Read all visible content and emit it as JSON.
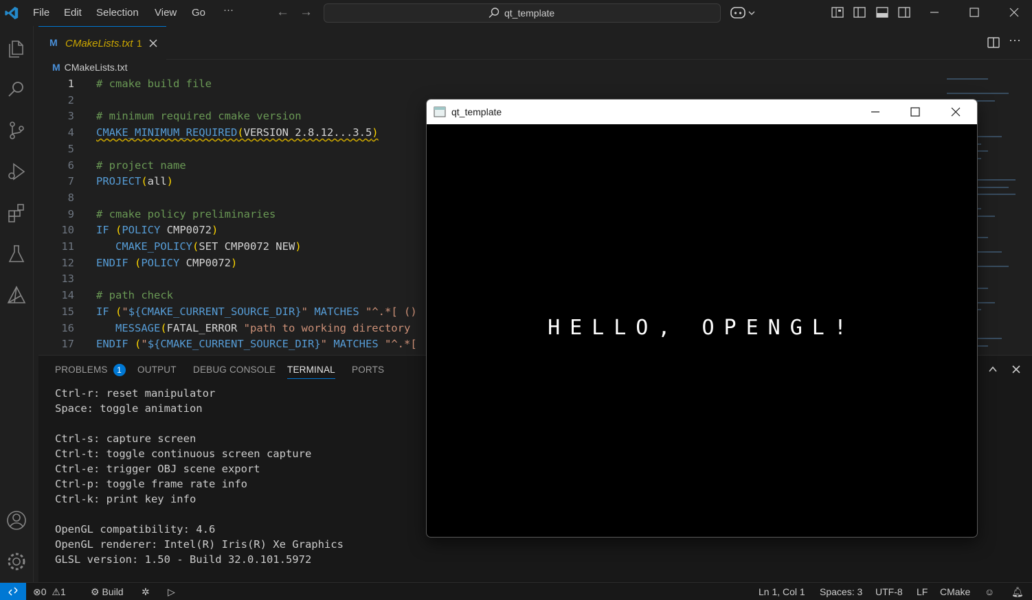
{
  "menu": [
    "File",
    "Edit",
    "Selection",
    "View",
    "Go",
    "···"
  ],
  "command_center": {
    "text": "qt_template"
  },
  "tab": {
    "label": "CMakeLists.txt",
    "problems": "1"
  },
  "breadcrumb": "CMakeLists.txt",
  "editor": {
    "lines": [
      {
        "n": "1",
        "parts": [
          {
            "c": "cm",
            "t": "# cmake build file"
          }
        ]
      },
      {
        "n": "2",
        "parts": []
      },
      {
        "n": "3",
        "parts": [
          {
            "c": "cm",
            "t": "# minimum required cmake version"
          }
        ]
      },
      {
        "n": "4",
        "parts": [
          {
            "c": "kw sq",
            "t": "CMAKE_MINIMUM_REQUIRED"
          },
          {
            "c": "pn sq",
            "t": "("
          },
          {
            "c": "tx sq",
            "t": "VERSION 2.8.12...3.5"
          },
          {
            "c": "pn sq",
            "t": ")"
          }
        ]
      },
      {
        "n": "5",
        "parts": []
      },
      {
        "n": "6",
        "parts": [
          {
            "c": "cm",
            "t": "# project name"
          }
        ]
      },
      {
        "n": "7",
        "parts": [
          {
            "c": "kw",
            "t": "PROJECT"
          },
          {
            "c": "pn",
            "t": "("
          },
          {
            "c": "tx",
            "t": "all"
          },
          {
            "c": "pn",
            "t": ")"
          }
        ]
      },
      {
        "n": "8",
        "parts": []
      },
      {
        "n": "9",
        "parts": [
          {
            "c": "cm",
            "t": "# cmake policy preliminaries"
          }
        ]
      },
      {
        "n": "10",
        "parts": [
          {
            "c": "kw",
            "t": "IF "
          },
          {
            "c": "pn",
            "t": "("
          },
          {
            "c": "kw",
            "t": "POLICY "
          },
          {
            "c": "tx",
            "t": "CMP0072"
          },
          {
            "c": "pn",
            "t": ")"
          }
        ]
      },
      {
        "n": "11",
        "parts": [
          {
            "c": "tx",
            "t": "   "
          },
          {
            "c": "kw",
            "t": "CMAKE_POLICY"
          },
          {
            "c": "pn",
            "t": "("
          },
          {
            "c": "tx",
            "t": "SET CMP0072 NEW"
          },
          {
            "c": "pn",
            "t": ")"
          }
        ]
      },
      {
        "n": "12",
        "parts": [
          {
            "c": "kw",
            "t": "ENDIF "
          },
          {
            "c": "pn",
            "t": "("
          },
          {
            "c": "kw",
            "t": "POLICY "
          },
          {
            "c": "tx",
            "t": "CMP0072"
          },
          {
            "c": "pn",
            "t": ")"
          }
        ]
      },
      {
        "n": "13",
        "parts": []
      },
      {
        "n": "14",
        "parts": [
          {
            "c": "cm",
            "t": "# path check"
          }
        ]
      },
      {
        "n": "15",
        "parts": [
          {
            "c": "kw",
            "t": "IF "
          },
          {
            "c": "pn",
            "t": "("
          },
          {
            "c": "st",
            "t": "\""
          },
          {
            "c": "kw",
            "t": "${CMAKE_CURRENT_SOURCE_DIR}"
          },
          {
            "c": "st",
            "t": "\""
          },
          {
            "c": "kw",
            "t": " MATCHES "
          },
          {
            "c": "st",
            "t": "\"^.*[ ()"
          }
        ]
      },
      {
        "n": "16",
        "parts": [
          {
            "c": "tx",
            "t": "   "
          },
          {
            "c": "kw",
            "t": "MESSAGE"
          },
          {
            "c": "pn",
            "t": "("
          },
          {
            "c": "tx",
            "t": "FATAL_ERROR "
          },
          {
            "c": "st",
            "t": "\"path to working directory"
          }
        ]
      },
      {
        "n": "17",
        "parts": [
          {
            "c": "kw",
            "t": "ENDIF "
          },
          {
            "c": "pn",
            "t": "("
          },
          {
            "c": "st",
            "t": "\""
          },
          {
            "c": "kw",
            "t": "${CMAKE_CURRENT_SOURCE_DIR}"
          },
          {
            "c": "st",
            "t": "\""
          },
          {
            "c": "kw",
            "t": " MATCHES "
          },
          {
            "c": "st",
            "t": "\"^.*["
          }
        ]
      }
    ]
  },
  "panel": {
    "tabs": [
      "PROBLEMS",
      "OUTPUT",
      "DEBUG CONSOLE",
      "TERMINAL",
      "PORTS"
    ],
    "problems_badge": "1",
    "terminal_lines": [
      "Ctrl-r: reset manipulator",
      "Space: toggle animation",
      "",
      "Ctrl-s: capture screen",
      "Ctrl-t: toggle continuous screen capture",
      "Ctrl-e: trigger OBJ scene export",
      "Ctrl-p: toggle frame rate info",
      "Ctrl-k: print key info",
      "",
      "OpenGL compatibility: 4.6",
      "OpenGL renderer: Intel(R) Iris(R) Xe Graphics",
      "GLSL version: 1.50 - Build 32.0.101.5972"
    ]
  },
  "statusbar": {
    "errors": "0",
    "warnings": "1",
    "build": "Build",
    "position": "Ln 1, Col 1",
    "spaces": "Spaces: 3",
    "encoding": "UTF-8",
    "eol": "LF",
    "language": "CMake"
  },
  "qt_window": {
    "title": "qt_template",
    "message": "HELLO, OPENGL!"
  },
  "colors": {
    "accent": "#0078d4",
    "background": "#1f1f1f",
    "panel": "#181818"
  }
}
